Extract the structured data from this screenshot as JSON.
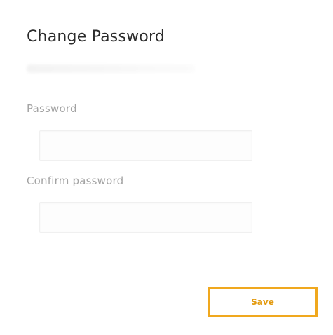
{
  "dialog": {
    "title": "Change Password"
  },
  "fields": {
    "password": {
      "label": "Password",
      "value": "",
      "placeholder": ""
    },
    "confirm_password": {
      "label": "Confirm password",
      "value": "",
      "placeholder": ""
    }
  },
  "actions": {
    "save_label": "Save"
  },
  "colors": {
    "accent": "#f0a81e",
    "title_text": "#2b2b2b",
    "label_text": "#a3a3a3"
  }
}
